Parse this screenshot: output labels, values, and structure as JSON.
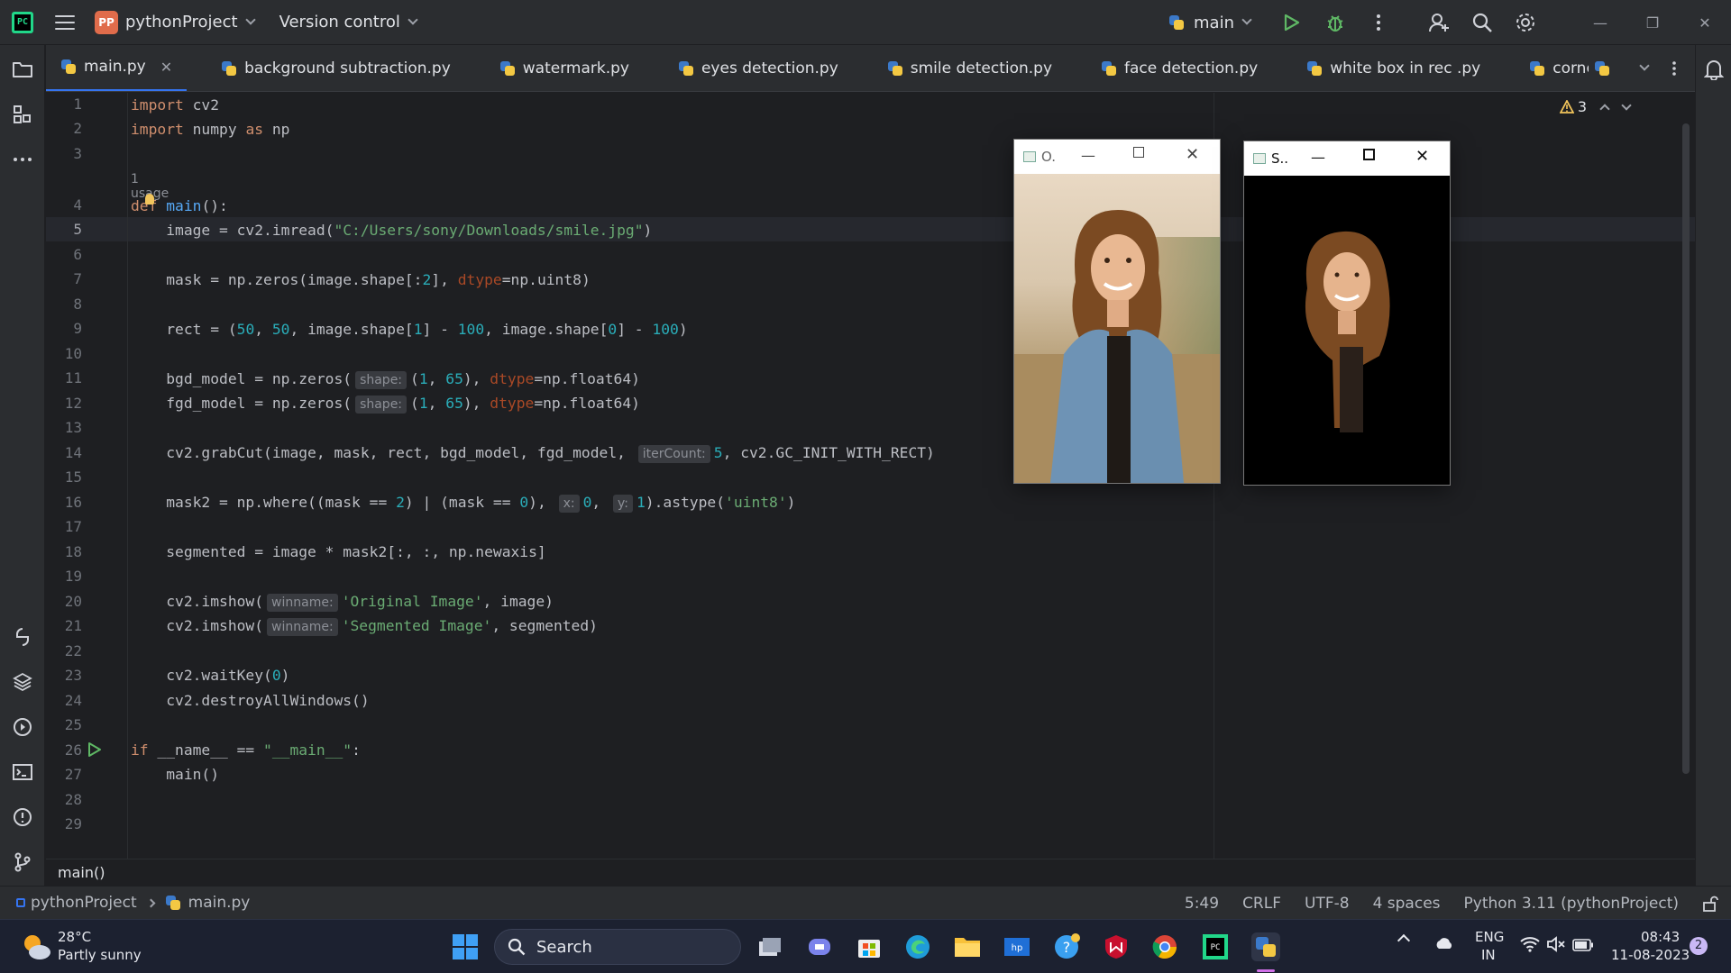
{
  "titlebar": {
    "project_badge": "PP",
    "project_name": "pythonProject",
    "vcs": "Version control",
    "run_config": "main"
  },
  "tabs": [
    {
      "label": "main.py",
      "active": true
    },
    {
      "label": "background subtraction.py"
    },
    {
      "label": "watermark.py"
    },
    {
      "label": "eyes detection.py"
    },
    {
      "label": "smile detection.py"
    },
    {
      "label": "face detection.py"
    },
    {
      "label": "white box in rec .py"
    },
    {
      "label": "corner detect.py"
    }
  ],
  "editor": {
    "warning_count": "3",
    "usage_hint": "1 usage",
    "line_numbers": [
      "1",
      "2",
      "3",
      "4",
      "5",
      "6",
      "7",
      "8",
      "9",
      "10",
      "11",
      "12",
      "13",
      "14",
      "15",
      "16",
      "17",
      "18",
      "19",
      "20",
      "21",
      "22",
      "23",
      "24",
      "25",
      "26",
      "27",
      "28",
      "29"
    ],
    "current_line": "5",
    "hints": {
      "shape": "shape:",
      "iterCount": "iterCount:",
      "x": "x:",
      "y": "y:",
      "winname": "winname:"
    },
    "code": {
      "l1": "import cv2",
      "l2": "import numpy as np",
      "l4": "def main():",
      "l5_path": "\"C:/Users/sony/Downloads/smile.jpg\"",
      "l20_str": "'Original Image'",
      "l21_str": "'Segmented Image'",
      "l26_str": "\"__main__\""
    }
  },
  "breadcrumb_bottom": "main()",
  "cv_windows": {
    "original_title": "O.",
    "segmented_title": "S.."
  },
  "statusbar": {
    "project": "pythonProject",
    "file": "main.py",
    "position": "5:49",
    "line_sep": "CRLF",
    "encoding": "UTF-8",
    "indent": "4 spaces",
    "interpreter": "Python 3.11 (pythonProject)"
  },
  "taskbar": {
    "weather_temp": "28°C",
    "weather_desc": "Partly sunny",
    "search_label": "Search",
    "lang_top": "ENG",
    "lang_bottom": "IN",
    "time": "08:43",
    "date": "11-08-2023",
    "notif_count": "2"
  },
  "colors": {
    "accent": "#3574f0",
    "keyword": "#cf8e6d",
    "function": "#56a8f5",
    "string": "#6aab73",
    "number": "#2aacb8"
  }
}
